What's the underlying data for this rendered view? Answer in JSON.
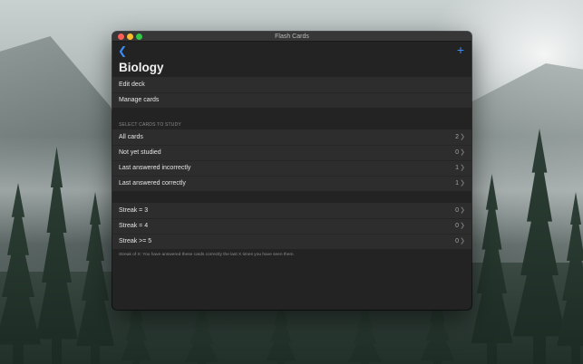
{
  "window": {
    "title": "Flash Cards"
  },
  "nav": {
    "back_icon": "chevron-left-icon",
    "add_icon": "plus-icon",
    "accent": "#3b8cf5"
  },
  "page": {
    "title": "Biology"
  },
  "deck_actions": [
    {
      "label": "Edit deck"
    },
    {
      "label": "Manage cards"
    }
  ],
  "study": {
    "header": "SELECT CARDS TO STUDY",
    "rows": [
      {
        "label": "All cards",
        "count": "2"
      },
      {
        "label": "Not yet studied",
        "count": "0"
      },
      {
        "label": "Last answered incorrectly",
        "count": "1"
      },
      {
        "label": "Last answered correctly",
        "count": "1"
      }
    ]
  },
  "streak": {
    "rows": [
      {
        "label": "Streak = 3",
        "count": "0"
      },
      {
        "label": "Streak = 4",
        "count": "0"
      },
      {
        "label": "Streak >= 5",
        "count": "0"
      }
    ],
    "footnote": "Streak of X: You have answered these cards correctly the last X times you have seen them."
  }
}
